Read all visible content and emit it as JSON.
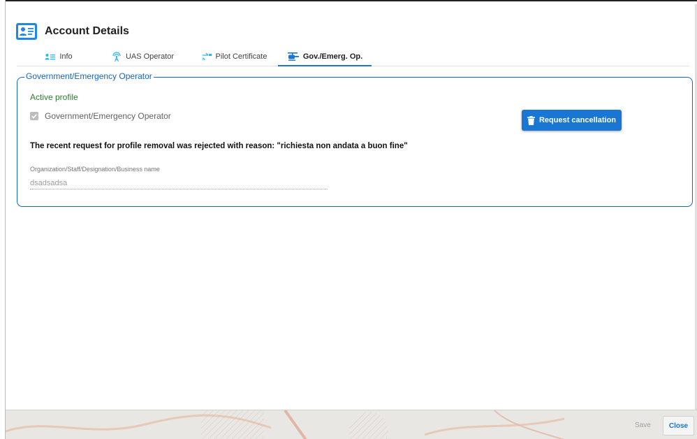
{
  "dialog": {
    "title": "Account Details",
    "icon": "account-card-icon"
  },
  "tabs": [
    {
      "label": "Info",
      "icon": "user-list-icon"
    },
    {
      "label": "UAS Operator",
      "icon": "antenna-icon"
    },
    {
      "label": "Pilot Certificate",
      "icon": "drone-pilot-icon"
    },
    {
      "label": "Gov./Emerg. Op.",
      "icon": "helicopter-icon",
      "active": true
    }
  ],
  "profile_section": {
    "legend": "Government/Emergency Operator",
    "status": "Active profile",
    "checkbox_label": "Government/Emergency Operator",
    "checkbox_checked": true,
    "request_button": "Request cancellation",
    "request_button_icon": "trash-icon",
    "rejection_message": "The recent request for profile removal was rejected with reason: \"richiesta non andata a buon fine\"",
    "org_field_label": "Organization/Staff/Designation/Business name",
    "org_field_value": "dsadsadsa"
  },
  "footer": {
    "save_label": "Save",
    "close_label": "Close"
  },
  "colors": {
    "accent": "#1976d2",
    "section_border": "#1565c0",
    "active_status": "#2e7d32"
  }
}
